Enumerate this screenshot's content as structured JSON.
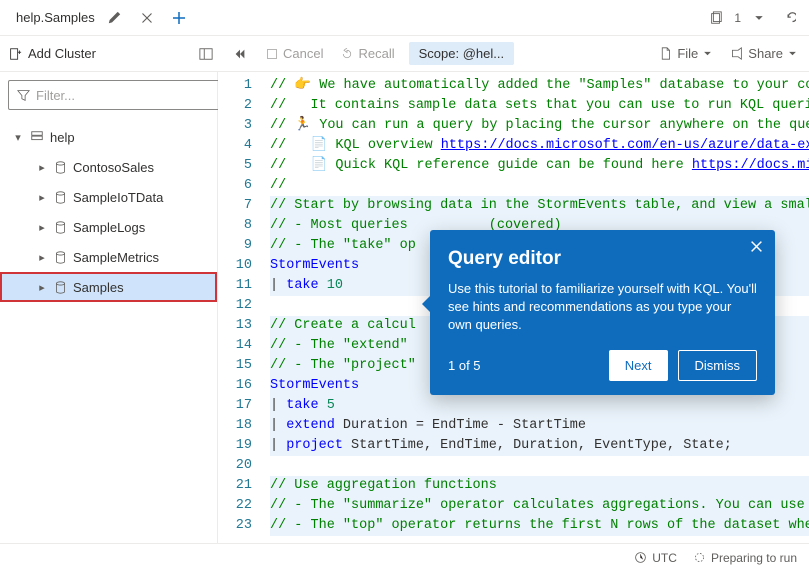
{
  "tab": {
    "title": "help.Samples"
  },
  "top_right": {
    "copies": "1"
  },
  "toolbar": {
    "add_cluster": "Add Cluster",
    "cancel": "Cancel",
    "recall": "Recall",
    "scope_prefix": "Scope: ",
    "scope_value": "@hel...",
    "file": "File",
    "share": "Share"
  },
  "filter": {
    "placeholder": "Filter..."
  },
  "tree": {
    "root": "help",
    "items": [
      {
        "label": "ContosoSales"
      },
      {
        "label": "SampleIoTData"
      },
      {
        "label": "SampleLogs"
      },
      {
        "label": "SampleMetrics"
      },
      {
        "label": "Samples",
        "selected": true,
        "highlighted": true
      }
    ]
  },
  "editor": {
    "lines": [
      "// 👉 We have automatically added the \"Samples\" database to your co",
      "//   It contains sample data sets that you can use to run KQL queri",
      "// 🏃 You can run a query by placing the cursor anywhere on the que",
      "//   📄 KQL overview https://docs.microsoft.com/en-us/azure/data-expl",
      "//   📄 Quick KQL reference guide can be found here https://docs.micr",
      "//",
      "// Start by browsing data in the StormEvents table, and view a small",
      "// - Most queries          (covered)",
      "// - The \"take\" op                                                                 (i",
      "StormEvents",
      "| take 10",
      "",
      "// Create a calcul",
      "// - The \"extend\"",
      "// - The \"project\"",
      "StormEvents",
      "| take 5",
      "| extend Duration = EndTime - StartTime",
      "| project StartTime, EndTime, Duration, EventType, State;",
      "",
      "// Use aggregation functions",
      "// - The \"summarize\" operator calculates aggregations. You can use s",
      "// - The \"top\" operator returns the first N rows of the dataset when"
    ]
  },
  "callout": {
    "title": "Query editor",
    "body": "Use this tutorial to familiarize yourself with KQL. You'll see hints and recommendations as you type your own queries.",
    "step": "1 of 5",
    "next": "Next",
    "dismiss": "Dismiss"
  },
  "status": {
    "tz": "UTC",
    "state": "Preparing to run"
  }
}
